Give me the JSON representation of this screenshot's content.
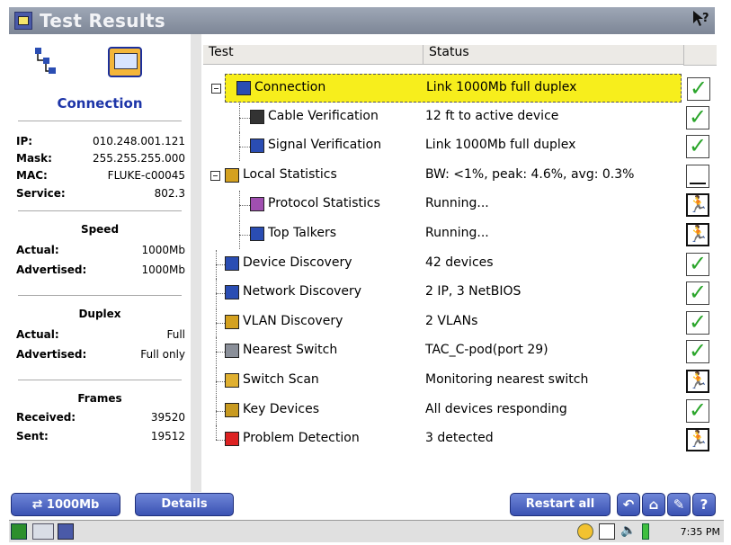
{
  "window": {
    "title": "Test Results",
    "help_glyph": "?"
  },
  "connection": {
    "label": "Connection",
    "ip_label": "IP:",
    "ip": "010.248.001.121",
    "mask_label": "Mask:",
    "mask": "255.255.255.000",
    "mac_label": "MAC:",
    "mac": "FLUKE-c00045",
    "service_label": "Service:",
    "service": "802.3"
  },
  "speed": {
    "heading": "Speed",
    "actual_label": "Actual:",
    "actual": "1000Mb",
    "advertised_label": "Advertised:",
    "advertised": "1000Mb"
  },
  "duplex": {
    "heading": "Duplex",
    "actual_label": "Actual:",
    "actual": "Full",
    "advertised_label": "Advertised:",
    "advertised": "Full only"
  },
  "frames": {
    "heading": "Frames",
    "received_label": "Received:",
    "received": "39520",
    "sent_label": "Sent:",
    "sent": "19512"
  },
  "table": {
    "col_test": "Test",
    "col_status": "Status",
    "rows": [
      {
        "name": "Connection",
        "status": "Link 1000Mb full duplex",
        "state": "pass",
        "icon": "connection-icon"
      },
      {
        "name": "Cable Verification",
        "status": "12 ft to active device",
        "state": "pass",
        "icon": "cable-icon"
      },
      {
        "name": "Signal Verification",
        "status": "Link 1000Mb full duplex",
        "state": "pass",
        "icon": "signal-icon"
      },
      {
        "name": "Local Statistics",
        "status": "BW: <1%, peak: 4.6%, avg: 0.3%",
        "state": "meter",
        "icon": "statistics-icon"
      },
      {
        "name": "Protocol Statistics",
        "status": "Running...",
        "state": "running",
        "icon": "protocol-icon"
      },
      {
        "name": "Top Talkers",
        "status": "Running...",
        "state": "running",
        "icon": "top-talkers-icon"
      },
      {
        "name": "Device Discovery",
        "status": "42 devices",
        "state": "pass",
        "icon": "device-icon"
      },
      {
        "name": "Network Discovery",
        "status": "2 IP, 3 NetBIOS",
        "state": "pass",
        "icon": "network-icon"
      },
      {
        "name": "VLAN Discovery",
        "status": "2 VLANs",
        "state": "pass",
        "icon": "vlan-icon"
      },
      {
        "name": "Nearest Switch",
        "status": "TAC_C-pod(port 29)",
        "state": "pass",
        "icon": "switch-icon"
      },
      {
        "name": "Switch Scan",
        "status": "Monitoring nearest switch",
        "state": "running",
        "icon": "scan-icon"
      },
      {
        "name": "Key Devices",
        "status": "All devices responding",
        "state": "pass",
        "icon": "key-icon"
      },
      {
        "name": "Problem Detection",
        "status": "3 detected",
        "state": "running",
        "icon": "problem-icon"
      }
    ]
  },
  "toolbar": {
    "speed_button": "1000Mb",
    "details_button": "Details",
    "restart_button": "Restart all"
  },
  "taskbar": {
    "clock": "7:35 PM"
  },
  "colors": {
    "highlight": "#f7ee1c",
    "accent": "#1d35a8",
    "pass": "#2aa52a"
  }
}
